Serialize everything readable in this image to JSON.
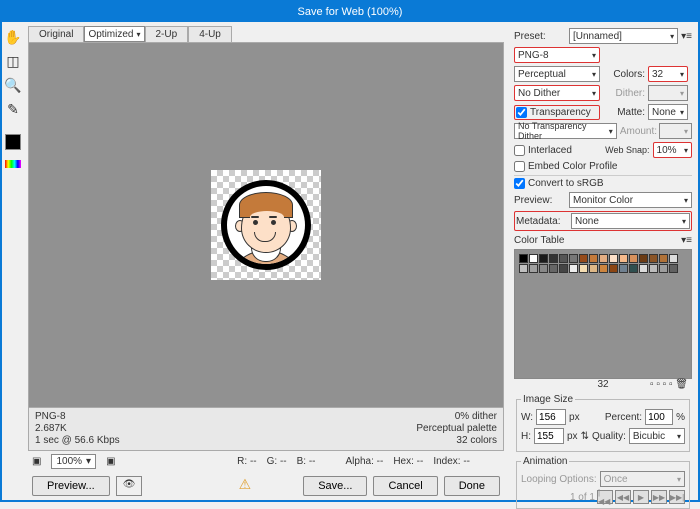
{
  "title": "Save for Web (100%)",
  "tabs": [
    "Original",
    "Optimized",
    "2-Up",
    "4-Up"
  ],
  "info": {
    "fmt": "PNG-8",
    "size": "2.687K",
    "time": "1 sec @ 56.6 Kbps",
    "dither": "0% dither",
    "palette": "Perceptual palette",
    "colors": "32 colors"
  },
  "zoom": "100%",
  "readout": {
    "r": "R: --",
    "g": "G: --",
    "b": "B: --",
    "alpha": "Alpha: --",
    "hex": "Hex: --",
    "index": "Index: --"
  },
  "buttons": {
    "preview": "Preview...",
    "save": "Save...",
    "cancel": "Cancel",
    "done": "Done"
  },
  "preset": {
    "label": "Preset:",
    "value": "[Unnamed]"
  },
  "format": "PNG-8",
  "reduction": "Perceptual",
  "colors": {
    "label": "Colors:",
    "value": "32"
  },
  "dither_method": "No Dither",
  "dither_amt": {
    "label": "Dither:",
    "value": ""
  },
  "transparency": {
    "label": "Transparency",
    "checked": true
  },
  "matte": {
    "label": "Matte:",
    "value": "None"
  },
  "trans_dither": "No Transparency Dither",
  "amount": {
    "label": "Amount:",
    "value": ""
  },
  "interlaced": {
    "label": "Interlaced",
    "checked": false
  },
  "websnap": {
    "label": "Web Snap:",
    "value": "10%"
  },
  "embed": {
    "label": "Embed Color Profile",
    "checked": false
  },
  "convert_srgb": {
    "label": "Convert to sRGB",
    "checked": true
  },
  "preview_sel": {
    "label": "Preview:",
    "value": "Monitor Color"
  },
  "metadata": {
    "label": "Metadata:",
    "value": "None"
  },
  "colortable": {
    "label": "Color Table",
    "count": "32"
  },
  "swatches": [
    "#000",
    "#fff",
    "#1a1a1a",
    "#333",
    "#555",
    "#777",
    "#964b1a",
    "#c47a3a",
    "#e3ad82",
    "#fde0c8",
    "#f6b98a",
    "#d7915c",
    "#6b3b14",
    "#8a5426",
    "#b07238",
    "#dcdcdc",
    "#c0c0c0",
    "#a0a0a0",
    "#888",
    "#666",
    "#444",
    "#eee",
    "#f5deb3",
    "#deb887",
    "#cd853f",
    "#8b4513",
    "#708090",
    "#2f4f4f",
    "#dcdcdc",
    "#bdbdbd",
    "#9e9e9e",
    "#616161"
  ],
  "image_size": {
    "legend": "Image Size",
    "w": "156",
    "h": "155",
    "percent": "100",
    "quality": "Bicubic"
  },
  "animation": {
    "legend": "Animation",
    "loop": "Once",
    "frame": "1 of 1"
  }
}
